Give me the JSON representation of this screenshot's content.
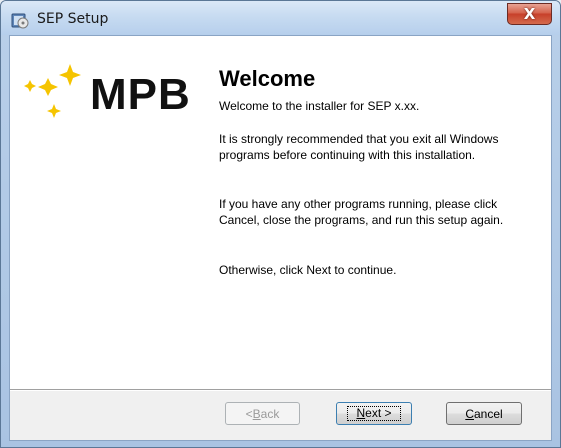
{
  "window": {
    "title": "SEP Setup",
    "close_glyph": "X",
    "app_icon": "installer-disc-icon"
  },
  "logo": {
    "text": "MPB",
    "icon": "sparkle-stars-icon",
    "star_color": "#f5c400"
  },
  "main": {
    "heading": "Welcome",
    "paragraphs": [
      "Welcome to the installer for SEP x.xx.",
      "It is strongly recommended that you exit all Windows programs before continuing with this installation.",
      "If you have any other programs running, please click Cancel, close the programs, and run this setup again.",
      "Otherwise, click Next to continue."
    ]
  },
  "buttons": {
    "back": {
      "mnemonic": "B",
      "rest": "ack",
      "prefix": "< ",
      "enabled": false
    },
    "next": {
      "mnemonic": "N",
      "rest": "ext >",
      "enabled": true,
      "default": true
    },
    "cancel": {
      "mnemonic": "C",
      "rest": "ancel",
      "enabled": true
    }
  }
}
